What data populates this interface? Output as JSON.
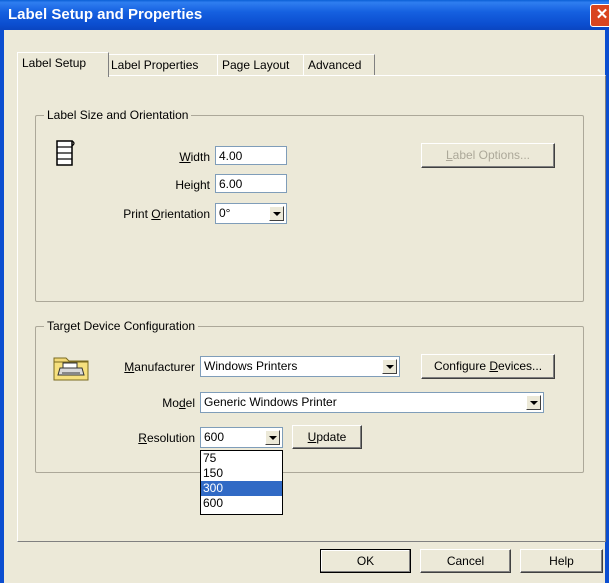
{
  "window": {
    "title": "Label Setup and Properties",
    "close_glyph": "✕"
  },
  "tabs": [
    {
      "label": "Label Setup",
      "active": true
    },
    {
      "label": "Label Properties",
      "active": false
    },
    {
      "label": "Page Layout",
      "active": false
    },
    {
      "label": "Advanced",
      "active": false
    }
  ],
  "label_size": {
    "group_title": "Label Size and Orientation",
    "width_label_prefix": "",
    "width_label_accel": "W",
    "width_label_rest": "idth",
    "width_value": "4.00",
    "height_label": "Height",
    "height_value": "6.00",
    "orientation_label_prefix": "Print ",
    "orientation_label_accel": "O",
    "orientation_label_rest": "rientation",
    "orientation_value": "0°",
    "label_options_accel": "L",
    "label_options_rest": "abel Options...",
    "label_options_enabled": false,
    "icon": "label-stack-icon"
  },
  "target_device": {
    "group_title": "Target Device Configuration",
    "manufacturer_label_accel": "M",
    "manufacturer_label_rest": "anufacturer",
    "manufacturer_value": "Windows Printers",
    "configure_prefix": "Configure ",
    "configure_accel": "D",
    "configure_rest": "evices...",
    "model_label_prefix": "Mo",
    "model_label_accel": "d",
    "model_label_rest": "el",
    "model_value": "Generic Windows Printer",
    "resolution_label_accel": "R",
    "resolution_label_rest": "esolution",
    "resolution_value": "600",
    "resolution_options": [
      "75",
      "150",
      "300",
      "600"
    ],
    "resolution_highlighted": "300",
    "update_accel": "U",
    "update_rest": "pdate",
    "icon": "printer-folder-icon"
  },
  "footer": {
    "ok_label": "OK",
    "cancel_label": "Cancel",
    "help_label": "Help"
  },
  "colors": {
    "titlebar": "#0b4ed0",
    "dialog_bg": "#ece9d8",
    "selection": "#316ac5",
    "close": "#d9451f"
  }
}
